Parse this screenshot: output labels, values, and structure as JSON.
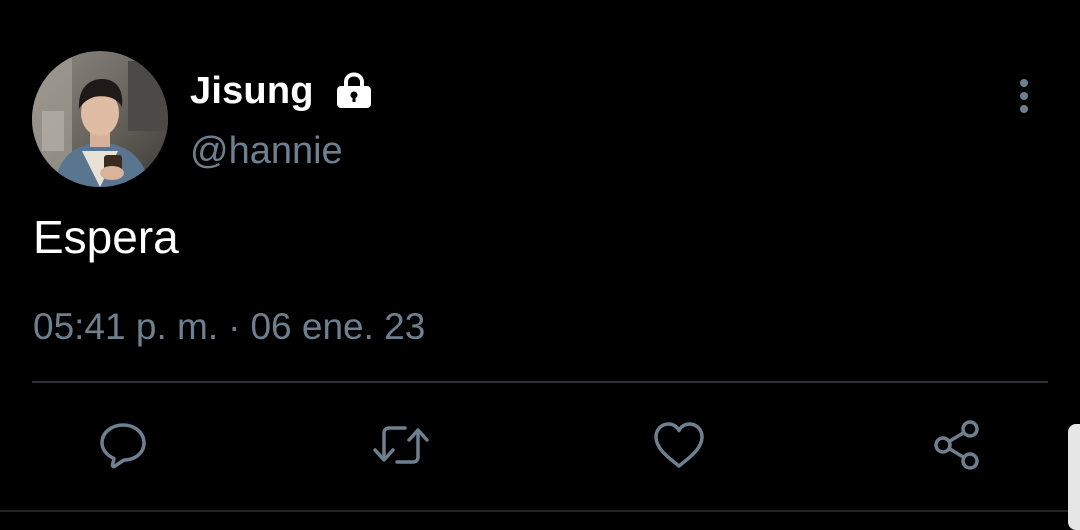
{
  "tweet": {
    "display_name": "Jisung",
    "handle": "@hannie",
    "text": "Espera",
    "time": "05:41 p. m.",
    "separator": "·",
    "date": "06 ene. 23",
    "protected_icon": "lock-icon",
    "more_icon": "more-vertical-icon"
  },
  "actions": [
    {
      "name": "reply",
      "icon": "reply-icon"
    },
    {
      "name": "retweet",
      "icon": "retweet-icon"
    },
    {
      "name": "like",
      "icon": "heart-icon"
    },
    {
      "name": "share",
      "icon": "share-icon"
    }
  ],
  "colors": {
    "background": "#000000",
    "primary_text": "#ffffff",
    "secondary_text": "#6e7f8f",
    "divider": "#2a3138"
  }
}
